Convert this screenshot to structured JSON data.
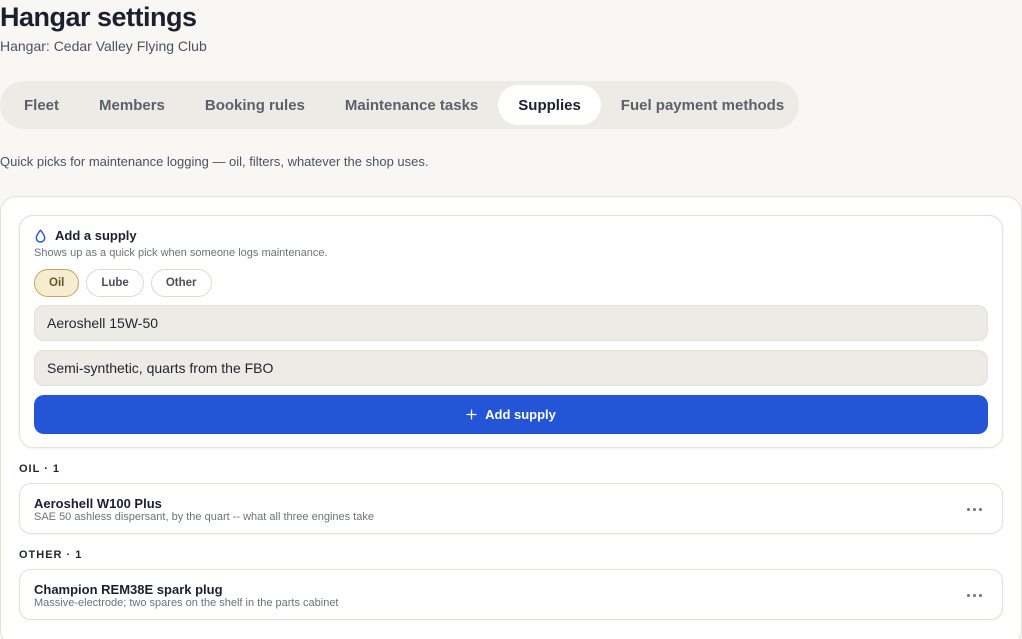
{
  "header": {
    "title": "Hangar settings",
    "subtitle": "Hangar: Cedar Valley Flying Club"
  },
  "tabs": [
    {
      "label": "Fleet",
      "active": false
    },
    {
      "label": "Members",
      "active": false
    },
    {
      "label": "Booking rules",
      "active": false
    },
    {
      "label": "Maintenance tasks",
      "active": false
    },
    {
      "label": "Supplies",
      "active": true
    },
    {
      "label": "Fuel payment methods",
      "active": false
    }
  ],
  "tab_description": "Quick picks for maintenance logging — oil, filters, whatever the shop uses.",
  "add_supply": {
    "icon": "droplet-icon",
    "title": "Add a supply",
    "hint": "Shows up as a quick pick when someone logs maintenance.",
    "categories": [
      {
        "label": "Oil",
        "selected": true
      },
      {
        "label": "Lube",
        "selected": false
      },
      {
        "label": "Other",
        "selected": false
      }
    ],
    "name_value": "Aeroshell 15W-50",
    "notes_value": "Semi-synthetic, quarts from the FBO",
    "button_label": "Add supply",
    "button_icon": "plus-icon"
  },
  "sections": [
    {
      "label": "OIL · 1",
      "items": [
        {
          "name": "Aeroshell W100 Plus",
          "description": "SAE 50 ashless dispersant, by the quart -- what all three engines take"
        }
      ]
    },
    {
      "label": "OTHER · 1",
      "items": [
        {
          "name": "Champion REM38E spark plug",
          "description": "Massive-electrode; two spares on the shelf in the parts cabinet"
        }
      ]
    }
  ],
  "colors": {
    "background": "#f8f7f3",
    "accent": "#2355d6",
    "chip_selected_bg": "#f6ecd0",
    "chip_selected_border": "#c9a45a"
  }
}
